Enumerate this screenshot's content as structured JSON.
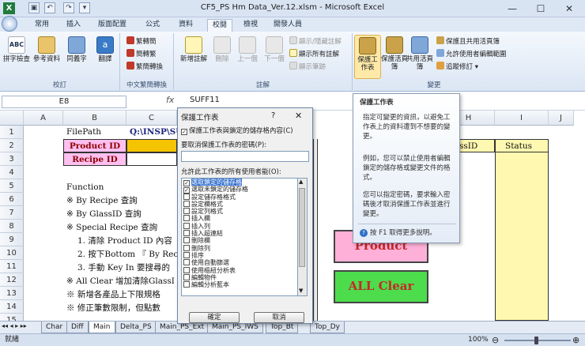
{
  "window": {
    "title": "CF5_PS Hm Data_Ver.12.xlsm - Microsoft Excel",
    "minimize": "—",
    "maximize": "☐",
    "close": "✕"
  },
  "tabs": [
    "常用",
    "插入",
    "版面配置",
    "公式",
    "資料",
    "校閱",
    "檢視",
    "開發人員"
  ],
  "ribbon": {
    "proofing": {
      "label": "校訂",
      "spelling": "拼字檢查",
      "research": "參考資料",
      "thesaurus": "同義字",
      "translate": "翻譯"
    },
    "chinese": {
      "label": "中文繁簡轉換",
      "to_trad": "繁轉簡",
      "to_simp": "簡轉繁",
      "convert": "繁簡轉換"
    },
    "comments": {
      "label": "註解",
      "new": "新增註解",
      "delete": "刪除",
      "prev": "上一個",
      "next": "下一個",
      "show_hide": "顯示/隱藏註解",
      "show_all": "顯示所有註解",
      "show_ink": "顯示筆跡"
    },
    "changes": {
      "label": "變更",
      "protect_sheet": "保護工作表",
      "protect_book": "保護活頁簿",
      "share_book": "共用活頁簿",
      "protect_share": "保護且共用活頁簿",
      "allow_edit": "允許使用者編輯範圍",
      "track": "追蹤修訂"
    }
  },
  "formula_bar": {
    "name_box": "E8",
    "fx": "fx",
    "value": "SUFF11"
  },
  "columns": [
    "A",
    "B",
    "C",
    "H",
    "I",
    "J"
  ],
  "rows": [
    "1",
    "2",
    "3",
    "4",
    "5",
    "6",
    "7",
    "8",
    "9",
    "10",
    "11",
    "12",
    "13",
    "14",
    "15"
  ],
  "cells": {
    "filepath_label": "FilePath",
    "filepath_value": "Q:\\INSP\\SU",
    "product_id": "Product ID",
    "recipe_id": "Recipe ID",
    "header_h2": "GlassID",
    "header_i2": "Status",
    "function": "Function",
    "l1": "※ By Recipe 查詢",
    "l2": "※ By GlassID 查詢",
    "l3": "※ Special Recipe 查詢",
    "l4": "1. 清除 Product ID 內容",
    "l5": "2. 按下Bottom 『 By Rec",
    "l6": "3. 手動 Key In 要搜尋的",
    "l7": "※ All Clear 增加清除GlassI",
    "l8": "※ 新增各產品上下限規格",
    "l9": "※ 修正筆數限制，但點數",
    "btn_product": "Product",
    "btn_allclear": "ALL Clear"
  },
  "dialog": {
    "title": "保護工作表",
    "help": "?",
    "close": "✕",
    "protect_label": "保護工作表與鎖定的儲存格內容(C)",
    "password_label": "要取消保護工作表的密碼(P):",
    "allow_label": "允許此工作表的所有使用者能(O):",
    "permissions": [
      {
        "label": "選取鎖定的儲存格",
        "checked": true,
        "selected": true
      },
      {
        "label": "選取未鎖定的儲存格",
        "checked": true,
        "selected": false
      },
      {
        "label": "設定儲存格格式",
        "checked": false,
        "selected": false
      },
      {
        "label": "設定欄格式",
        "checked": false,
        "selected": false
      },
      {
        "label": "設定列格式",
        "checked": false,
        "selected": false
      },
      {
        "label": "插入欄",
        "checked": false,
        "selected": false
      },
      {
        "label": "插入列",
        "checked": false,
        "selected": false
      },
      {
        "label": "插入超連結",
        "checked": false,
        "selected": false
      },
      {
        "label": "刪除欄",
        "checked": false,
        "selected": false
      },
      {
        "label": "刪除列",
        "checked": false,
        "selected": false
      },
      {
        "label": "排序",
        "checked": false,
        "selected": false
      },
      {
        "label": "使用自動篩選",
        "checked": false,
        "selected": false
      },
      {
        "label": "使用樞紐分析表",
        "checked": false,
        "selected": false
      },
      {
        "label": "編輯物件",
        "checked": false,
        "selected": false
      },
      {
        "label": "編輯分析藍本",
        "checked": false,
        "selected": false
      }
    ],
    "ok": "確定",
    "cancel": "取消"
  },
  "tooltip": {
    "title": "保護工作表",
    "p1": "指定可變更的資訊，以避免工作表上的資料遭到不想要的變更。",
    "p2": "例如，您可以禁止使用者編輯鎖定的儲存格或變更文件的格式。",
    "p3": "您可以指定密碼，要求輸入密碼後才取消保護工作表並進行變更。",
    "help": "按 F1 取得更多說明。"
  },
  "sheet_tabs": [
    "Char",
    "Diff",
    "Main",
    "Delta_PS",
    "Main_PS_Ext",
    "Main_PS_IWS",
    "Top_Bt",
    "Top_Dy"
  ],
  "status": {
    "ready": "就緒",
    "zoom": "100%"
  }
}
